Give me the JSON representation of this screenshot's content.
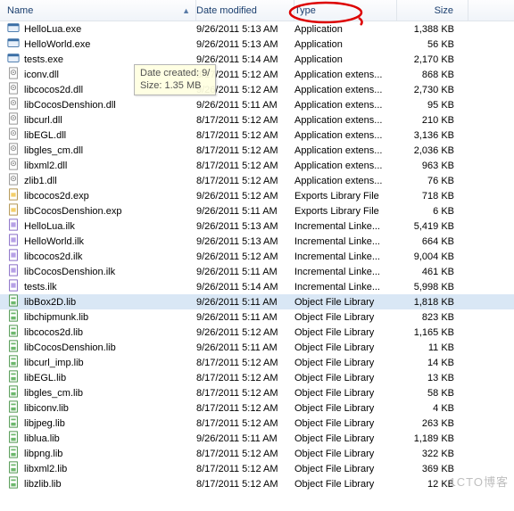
{
  "columns": {
    "name": "Name",
    "date": "Date modified",
    "type": "Type",
    "size": "Size"
  },
  "tooltip": {
    "line1": "Date created: 9/",
    "line2": "Size: 1.35 MB"
  },
  "watermark": "1CTO博客",
  "files": [
    {
      "icon": "exe",
      "name": "HelloLua.exe",
      "date": "9/26/2011 5:13 AM",
      "type": "Application",
      "size": "1,388 KB"
    },
    {
      "icon": "exe",
      "name": "HelloWorld.exe",
      "date": "9/26/2011 5:13 AM",
      "type": "Application",
      "size": "56 KB"
    },
    {
      "icon": "exe",
      "name": "tests.exe",
      "date": "9/26/2011 5:14 AM",
      "type": "Application",
      "size": "2,170 KB"
    },
    {
      "icon": "dll",
      "name": "iconv.dll",
      "date": "8/17/2011 5:12 AM",
      "type": "Application extens...",
      "size": "868 KB"
    },
    {
      "icon": "dll",
      "name": "libcocos2d.dll",
      "date": "9/26/2011 5:12 AM",
      "type": "Application extens...",
      "size": "2,730 KB"
    },
    {
      "icon": "dll",
      "name": "libCocosDenshion.dll",
      "date": "9/26/2011 5:11 AM",
      "type": "Application extens...",
      "size": "95 KB"
    },
    {
      "icon": "dll",
      "name": "libcurl.dll",
      "date": "8/17/2011 5:12 AM",
      "type": "Application extens...",
      "size": "210 KB"
    },
    {
      "icon": "dll",
      "name": "libEGL.dll",
      "date": "8/17/2011 5:12 AM",
      "type": "Application extens...",
      "size": "3,136 KB"
    },
    {
      "icon": "dll",
      "name": "libgles_cm.dll",
      "date": "8/17/2011 5:12 AM",
      "type": "Application extens...",
      "size": "2,036 KB"
    },
    {
      "icon": "dll",
      "name": "libxml2.dll",
      "date": "8/17/2011 5:12 AM",
      "type": "Application extens...",
      "size": "963 KB"
    },
    {
      "icon": "dll",
      "name": "zlib1.dll",
      "date": "8/17/2011 5:12 AM",
      "type": "Application extens...",
      "size": "76 KB"
    },
    {
      "icon": "exp",
      "name": "libcocos2d.exp",
      "date": "9/26/2011 5:12 AM",
      "type": "Exports Library File",
      "size": "718 KB"
    },
    {
      "icon": "exp",
      "name": "libCocosDenshion.exp",
      "date": "9/26/2011 5:11 AM",
      "type": "Exports Library File",
      "size": "6 KB"
    },
    {
      "icon": "ilk",
      "name": "HelloLua.ilk",
      "date": "9/26/2011 5:13 AM",
      "type": "Incremental Linke...",
      "size": "5,419 KB"
    },
    {
      "icon": "ilk",
      "name": "HelloWorld.ilk",
      "date": "9/26/2011 5:13 AM",
      "type": "Incremental Linke...",
      "size": "664 KB"
    },
    {
      "icon": "ilk",
      "name": "libcocos2d.ilk",
      "date": "9/26/2011 5:12 AM",
      "type": "Incremental Linke...",
      "size": "9,004 KB"
    },
    {
      "icon": "ilk",
      "name": "libCocosDenshion.ilk",
      "date": "9/26/2011 5:11 AM",
      "type": "Incremental Linke...",
      "size": "461 KB"
    },
    {
      "icon": "ilk",
      "name": "tests.ilk",
      "date": "9/26/2011 5:14 AM",
      "type": "Incremental Linke...",
      "size": "5,998 KB"
    },
    {
      "icon": "lib",
      "name": "libBox2D.lib",
      "date": "9/26/2011 5:11 AM",
      "type": "Object File Library",
      "size": "1,818 KB",
      "selected": true
    },
    {
      "icon": "lib",
      "name": "libchipmunk.lib",
      "date": "9/26/2011 5:11 AM",
      "type": "Object File Library",
      "size": "823 KB"
    },
    {
      "icon": "lib",
      "name": "libcocos2d.lib",
      "date": "9/26/2011 5:12 AM",
      "type": "Object File Library",
      "size": "1,165 KB"
    },
    {
      "icon": "lib",
      "name": "libCocosDenshion.lib",
      "date": "9/26/2011 5:11 AM",
      "type": "Object File Library",
      "size": "11 KB"
    },
    {
      "icon": "lib",
      "name": "libcurl_imp.lib",
      "date": "8/17/2011 5:12 AM",
      "type": "Object File Library",
      "size": "14 KB"
    },
    {
      "icon": "lib",
      "name": "libEGL.lib",
      "date": "8/17/2011 5:12 AM",
      "type": "Object File Library",
      "size": "13 KB"
    },
    {
      "icon": "lib",
      "name": "libgles_cm.lib",
      "date": "8/17/2011 5:12 AM",
      "type": "Object File Library",
      "size": "58 KB"
    },
    {
      "icon": "lib",
      "name": "libiconv.lib",
      "date": "8/17/2011 5:12 AM",
      "type": "Object File Library",
      "size": "4 KB"
    },
    {
      "icon": "lib",
      "name": "libjpeg.lib",
      "date": "8/17/2011 5:12 AM",
      "type": "Object File Library",
      "size": "263 KB"
    },
    {
      "icon": "lib",
      "name": "liblua.lib",
      "date": "9/26/2011 5:11 AM",
      "type": "Object File Library",
      "size": "1,189 KB"
    },
    {
      "icon": "lib",
      "name": "libpng.lib",
      "date": "8/17/2011 5:12 AM",
      "type": "Object File Library",
      "size": "322 KB"
    },
    {
      "icon": "lib",
      "name": "libxml2.lib",
      "date": "8/17/2011 5:12 AM",
      "type": "Object File Library",
      "size": "369 KB"
    },
    {
      "icon": "lib",
      "name": "libzlib.lib",
      "date": "8/17/2011 5:12 AM",
      "type": "Object File Library",
      "size": "12 KB"
    }
  ]
}
